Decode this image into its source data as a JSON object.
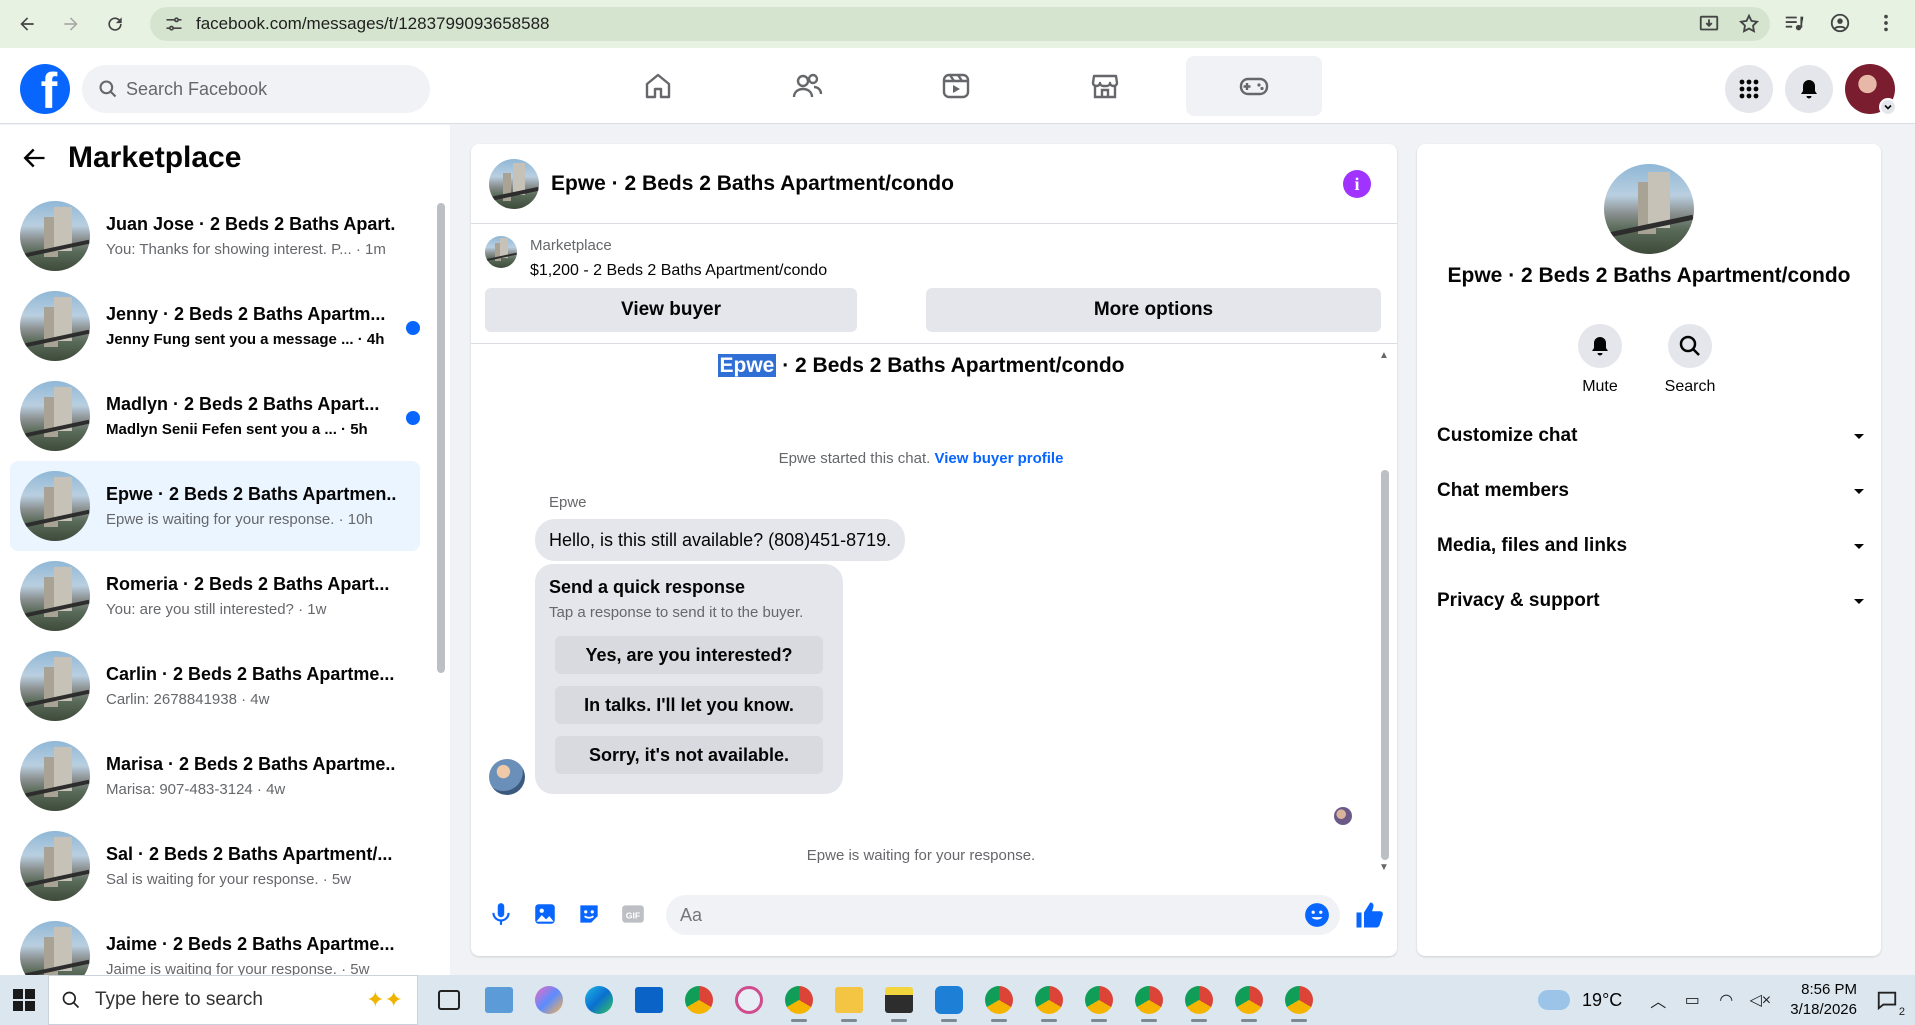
{
  "browser": {
    "url": "facebook.com/messages/t/1283799093658588"
  },
  "header": {
    "search_placeholder": "Search Facebook",
    "logo_letter": "f"
  },
  "sidebar": {
    "title": "Marketplace",
    "conversations": [
      {
        "name": "Juan Jose · 2 Beds 2 Baths Apart...",
        "preview": "You: Thanks for showing interest. P... · 1m",
        "unread": false,
        "active": false
      },
      {
        "name": "Jenny · 2 Beds 2 Baths Apartm...",
        "preview": "Jenny Fung sent you a message ... · 4h",
        "unread": true,
        "active": false
      },
      {
        "name": "Madlyn · 2 Beds 2 Baths Apart...",
        "preview": "Madlyn Senii Fefen sent you a ... · 5h",
        "unread": true,
        "active": false
      },
      {
        "name": "Epwe · 2 Beds 2 Baths Apartmen...",
        "preview": "Epwe is waiting for your response. · 10h",
        "unread": false,
        "active": true
      },
      {
        "name": "Romeria · 2 Beds 2 Baths Apart...",
        "preview": "You: are you still interested? · 1w",
        "unread": false,
        "active": false
      },
      {
        "name": "Carlin · 2 Beds 2 Baths Apartme...",
        "preview": "Carlin: 2678841938 · 4w",
        "unread": false,
        "active": false
      },
      {
        "name": "Marisa · 2 Beds 2 Baths Apartme...",
        "preview": "Marisa: 907-483-3124 · 4w",
        "unread": false,
        "active": false
      },
      {
        "name": "Sal · 2 Beds 2 Baths Apartment/...",
        "preview": "Sal is waiting for your response. · 5w",
        "unread": false,
        "active": false
      },
      {
        "name": "Jaime · 2 Beds 2 Baths Apartme...",
        "preview": "Jaime is waiting for your response. · 5w",
        "unread": false,
        "active": false
      }
    ]
  },
  "chat": {
    "title": "Epwe · 2 Beds 2 Baths Apartment/condo",
    "info_glyph": "i",
    "listing_label": "Marketplace",
    "listing_price": "$1,200 - 2 Beds 2 Baths Apartment/condo",
    "view_buyer": "View buyer",
    "more_options": "More options",
    "thread_title_highlight": "Epwe",
    "thread_title_rest": " · 2 Beds 2 Baths Apartment/condo",
    "started_text": "Epwe started this chat. ",
    "view_profile": "View buyer profile",
    "sender": "Epwe",
    "message": "Hello, is this still available? (808)451-8719.",
    "quick_title": "Send a quick response",
    "quick_sub": "Tap a response to send it to the buyer.",
    "quick_options": [
      "Yes, are you interested?",
      "In talks. I'll let you know.",
      "Sorry, it's not available."
    ],
    "waiting": "Epwe is waiting for your response.",
    "composer_placeholder": "Aa"
  },
  "info_panel": {
    "title": "Epwe · 2 Beds 2 Baths Apartment/condo",
    "mute": "Mute",
    "search": "Search",
    "rows": [
      "Customize chat",
      "Chat members",
      "Media, files and links",
      "Privacy & support"
    ]
  },
  "taskbar": {
    "search_placeholder": "Type here to search",
    "weather": "19°C",
    "time": "8:56 PM",
    "date": "3/18/2026",
    "notif_count": "2"
  },
  "colors": {
    "fb_blue": "#0866ff",
    "info_purple": "#a033ff"
  }
}
